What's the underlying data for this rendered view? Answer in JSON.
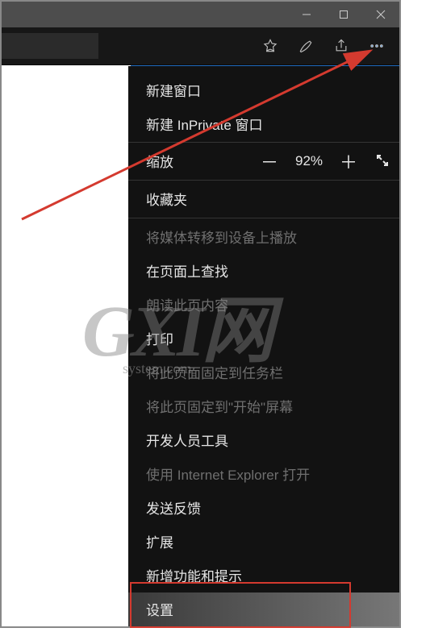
{
  "window": {
    "minimize_icon": "min",
    "maximize_icon": "max",
    "close_icon": "close"
  },
  "toolbar": {
    "favorites_icon": "star",
    "notes_icon": "pen",
    "share_icon": "share",
    "more_icon": "dots"
  },
  "zoom": {
    "label": "缩放",
    "minus": "－",
    "value": "92%",
    "plus": "＋"
  },
  "menu": {
    "new_window": "新建窗口",
    "new_inprivate": "新建 InPrivate 窗口",
    "favorites": "收藏夹",
    "cast": "将媒体转移到设备上播放",
    "find": "在页面上查找",
    "read_aloud": "朗读此页内容",
    "print": "打印",
    "pin_taskbar": "将此页面固定到任务栏",
    "pin_start": "将此页固定到\"开始\"屏幕",
    "devtools": "开发人员工具",
    "open_ie": "使用 Internet Explorer 打开",
    "feedback": "发送反馈",
    "extensions": "扩展",
    "whatsnew": "新增功能和提示",
    "settings": "设置"
  },
  "watermark": {
    "big": "GXI网",
    "small": "system.com"
  }
}
